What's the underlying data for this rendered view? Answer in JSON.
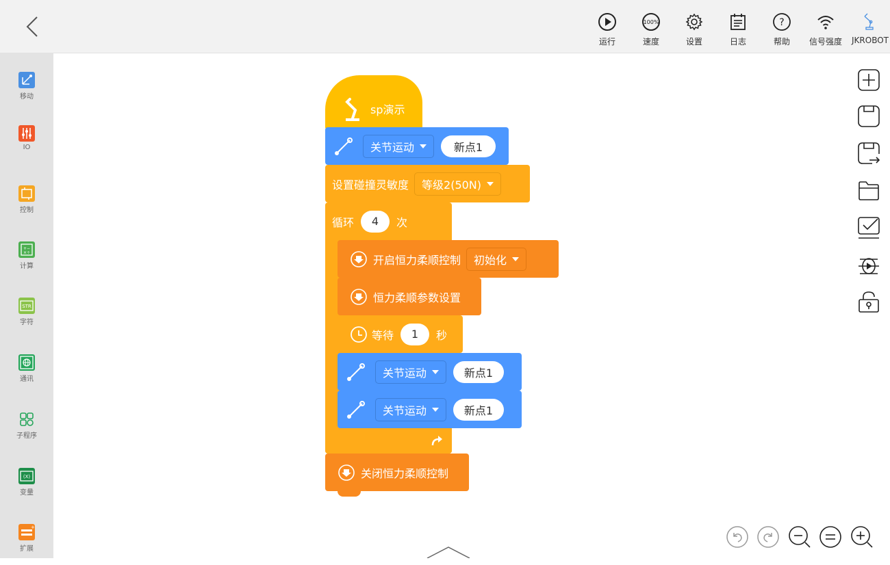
{
  "toolbar": {
    "back": "back",
    "items": [
      {
        "label": "运行",
        "icon": "play-circle-icon"
      },
      {
        "label": "速度",
        "icon": "speed-gauge-icon",
        "gauge_text": "100%"
      },
      {
        "label": "设置",
        "icon": "gear-icon"
      },
      {
        "label": "日志",
        "icon": "log-icon"
      },
      {
        "label": "帮助",
        "icon": "help-icon"
      },
      {
        "label": "信号强度",
        "icon": "wifi-icon"
      },
      {
        "label": "JKROBOT",
        "icon": "robot-arm-icon"
      }
    ]
  },
  "sidebar": {
    "items": [
      {
        "label": "移动",
        "color": "#4a90e2",
        "icon": "move-icon"
      },
      {
        "label": "IO",
        "color": "#f0582a",
        "icon": "io-icon"
      },
      {
        "label": "控制",
        "color": "#f5a623",
        "icon": "control-icon"
      },
      {
        "label": "计算",
        "color": "#4caf50",
        "icon": "calculate-icon"
      },
      {
        "label": "字符",
        "color": "#8bc34a",
        "icon": "string-icon",
        "icon_text": "STR"
      },
      {
        "label": "通讯",
        "color": "#26a65b",
        "icon": "globe-icon"
      },
      {
        "label": "子程序",
        "color": "#26a65b",
        "icon": "subprogram-icon"
      },
      {
        "label": "变量",
        "color": "#1e8e4a",
        "icon": "variable-icon",
        "icon_text": "(X)"
      },
      {
        "label": "扩展",
        "color": "#f5851f",
        "icon": "extension-icon"
      }
    ]
  },
  "program": {
    "hat_label": "sp演示",
    "joint_move_1": {
      "type": "关节运动",
      "point": "新点1"
    },
    "collision": {
      "label": "设置碰撞灵敏度",
      "level": "等级2(50N)"
    },
    "loop": {
      "label_prefix": "循环",
      "count": "4",
      "label_suffix": "次"
    },
    "force_on": {
      "label": "开启恒力柔顺控制",
      "mode": "初始化"
    },
    "force_params": {
      "label": "恒力柔顺参数设置"
    },
    "wait": {
      "label_prefix": "等待",
      "seconds": "1",
      "label_suffix": "秒"
    },
    "joint_move_2": {
      "type": "关节运动",
      "point": "新点1"
    },
    "joint_move_3": {
      "type": "关节运动",
      "point": "新点1"
    },
    "force_off": {
      "label": "关闭恒力柔顺控制"
    }
  },
  "colors": {
    "motion": "#4c97ff",
    "motion_dark": "#3d7fd9",
    "control": "#ffab19",
    "control_dark": "#e69a12",
    "force": "#f98a1f",
    "force_dark": "#e27812"
  }
}
